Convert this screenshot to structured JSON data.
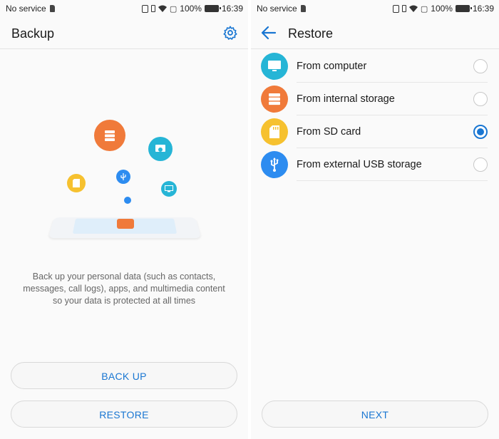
{
  "status_bar": {
    "carrier": "No service",
    "battery": "100%",
    "time": "16:39"
  },
  "backup_screen": {
    "title": "Backup",
    "settings_icon": "gear-icon",
    "description": "Back up your personal data (such as contacts, messages, call logs), apps, and multimedia content so your data is protected at all times",
    "back_up_label": "BACK UP",
    "restore_label": "RESTORE",
    "colors": {
      "accent": "#1976d2",
      "orange": "#f07a3a",
      "teal": "#26b5d6",
      "yellow": "#f6c12f",
      "blue": "#2d8cf0"
    }
  },
  "restore_screen": {
    "title": "Restore",
    "back_icon": "arrow-left-icon",
    "options": [
      {
        "label": "From computer",
        "icon": "monitor-icon",
        "color": "#26b5d6",
        "selected": false
      },
      {
        "label": "From internal storage",
        "icon": "storage-icon",
        "color": "#f07a3a",
        "selected": false
      },
      {
        "label": "From SD card",
        "icon": "sd-card-icon",
        "color": "#f6c12f",
        "selected": true
      },
      {
        "label": "From external USB storage",
        "icon": "usb-icon",
        "color": "#2d8cf0",
        "selected": false
      }
    ],
    "next_label": "NEXT"
  }
}
